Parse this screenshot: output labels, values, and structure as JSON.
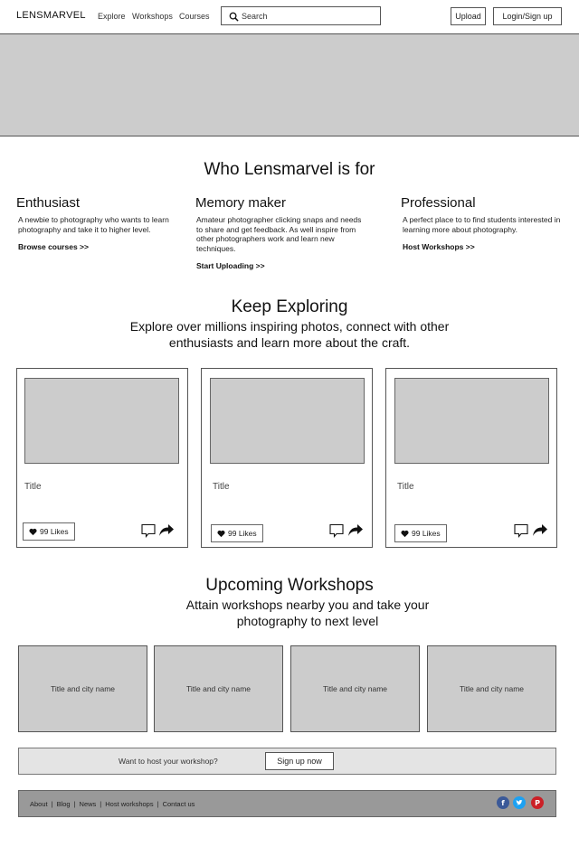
{
  "header": {
    "logo": "LENSMARVEL",
    "nav": [
      "Explore",
      "Workshops",
      "Courses"
    ],
    "search_placeholder": "Search",
    "upload_label": "Upload",
    "login_label": "Login/Sign up"
  },
  "audience": {
    "title": "Who Lensmarvel is for",
    "items": [
      {
        "heading": "Enthusiast",
        "text": "A newbie to photography who wants to learn photography and take it to higher level.",
        "link": "Browse courses >>"
      },
      {
        "heading": "Memory maker",
        "text": "Amateur photographer clicking snaps and needs to share and get feedback. As well inspire from other photographers work and learn new techniques.",
        "link": "Start Uploading >>"
      },
      {
        "heading": "Professional",
        "text": "A perfect place to to find students interested in learning more about photography.",
        "link": "Host Workshops >>"
      }
    ]
  },
  "explore": {
    "title": "Keep Exploring",
    "subtitle": "Explore over millions inspiring photos, connect with other enthusiasts and learn more about the craft.",
    "cards": [
      {
        "title": "Title",
        "likes": "99 Likes"
      },
      {
        "title": "Title",
        "likes": "99 Likes"
      },
      {
        "title": "Title",
        "likes": "99 Likes"
      }
    ]
  },
  "workshops": {
    "title": "Upcoming Workshops",
    "subtitle": "Attain workshops nearby you and take your photography to next level",
    "items": [
      "Title and city name",
      "Title and city name",
      "Title and city name",
      "Title and city name"
    ]
  },
  "host": {
    "text": "Want to host your workshop?",
    "button": "Sign up now"
  },
  "footer": {
    "links": [
      "About",
      "Blog",
      "News",
      "Host workshops",
      "Contact us"
    ],
    "social_icons": [
      "facebook-icon",
      "twitter-icon",
      "pinterest-icon"
    ],
    "social_colors": [
      "#3b5998",
      "#1da1f2",
      "#cb2027"
    ]
  }
}
